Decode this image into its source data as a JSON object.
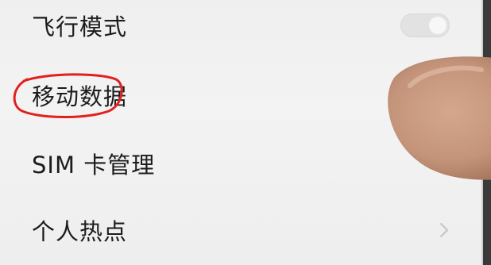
{
  "settings": {
    "items": [
      {
        "label": "飞行模式",
        "control": "toggle",
        "state": "off"
      },
      {
        "label": "移动数据",
        "control": "none",
        "highlighted": true
      },
      {
        "label": "SIM 卡管理",
        "control": "none"
      },
      {
        "label": "个人热点",
        "control": "chevron",
        "icon": "chevron-right-icon"
      }
    ]
  },
  "annotation": {
    "shape": "circle",
    "color": "#e0221f",
    "target": "移动数据"
  },
  "colors": {
    "background": "#f0f0f0",
    "text": "#1c1c1c",
    "annotation": "#e0221f"
  }
}
